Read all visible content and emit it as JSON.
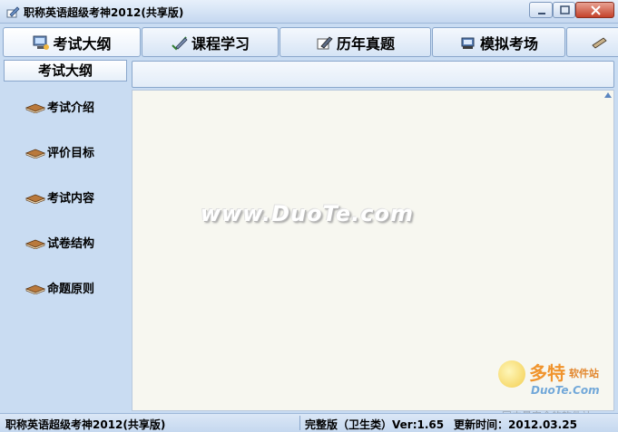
{
  "window": {
    "title": "职称英语超级考神2012(共享版)",
    "icon": "app-pen-icon"
  },
  "tabs": [
    {
      "label": "考试大纲",
      "icon": "monitor-icon",
      "active": true
    },
    {
      "label": "课程学习",
      "icon": "pencil-check-icon",
      "active": false
    },
    {
      "label": "历年真题",
      "icon": "pencil-paper-icon",
      "active": false
    },
    {
      "label": "模拟考场",
      "icon": "exam-desk-icon",
      "active": false
    },
    {
      "label": "",
      "icon": "pencil-icon",
      "active": false
    }
  ],
  "sidebar": {
    "header": "考试大纲",
    "items": [
      {
        "label": "考试介绍",
        "icon": "book-icon"
      },
      {
        "label": "评价目标",
        "icon": "book-icon"
      },
      {
        "label": "考试内容",
        "icon": "book-icon"
      },
      {
        "label": "试卷结构",
        "icon": "book-icon"
      },
      {
        "label": "命题原则",
        "icon": "book-icon"
      }
    ]
  },
  "content": {
    "watermark": "www.DuoTe.com"
  },
  "branding": {
    "logo_big": "多特",
    "logo_small": "软件站",
    "logo_url": "DuoTe.Com",
    "tagline": "国内最安全的软件站"
  },
  "status": {
    "app_name": "职称英语超级考神2012(共享版)",
    "edition": "完整版（卫生类）Ver:1.65",
    "update": "更新时间：2012.03.25"
  },
  "colors": {
    "chrome": "#c9dcf2",
    "content_bg": "#f7f7f0",
    "border": "#8aa7cc"
  }
}
